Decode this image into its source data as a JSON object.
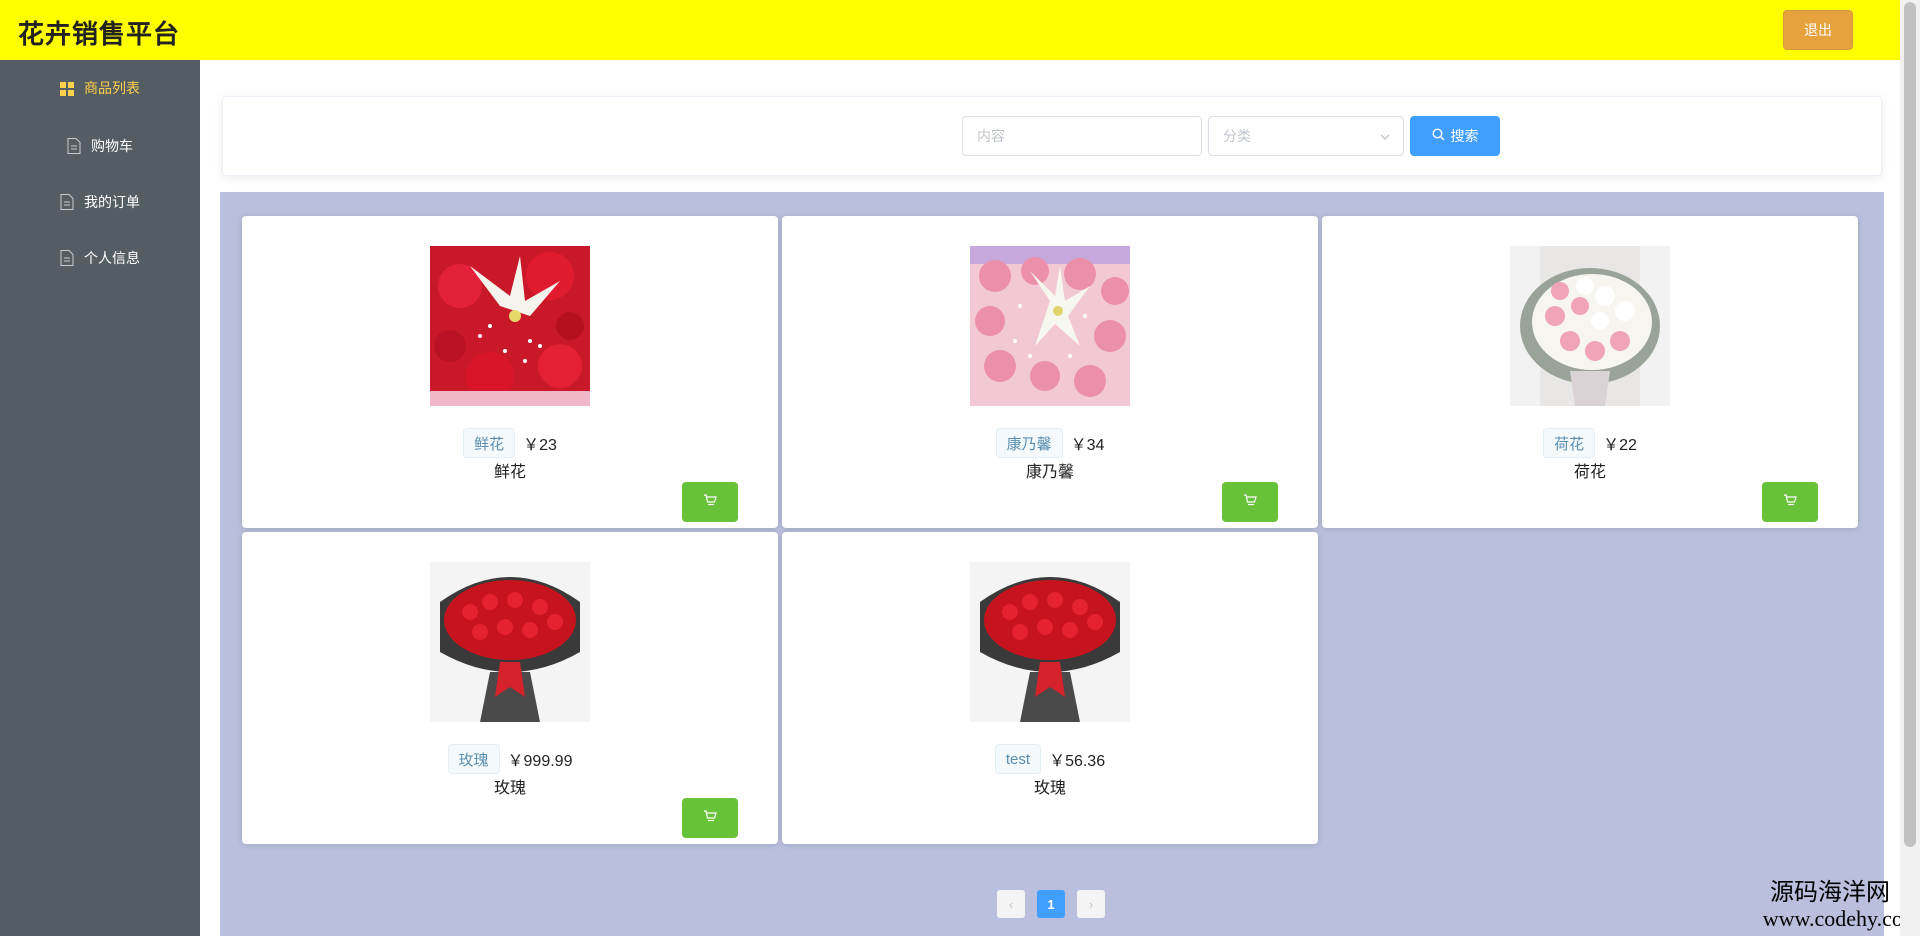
{
  "header": {
    "title": "花卉销售平台",
    "logout_label": "退出"
  },
  "sidebar": {
    "items": [
      {
        "label": "商品列表",
        "icon": "grid-icon",
        "active": true
      },
      {
        "label": "购物车",
        "icon": "document-icon",
        "active": false
      },
      {
        "label": "我的订单",
        "icon": "document-icon",
        "active": false
      },
      {
        "label": "个人信息",
        "icon": "document-icon",
        "active": false
      }
    ]
  },
  "search": {
    "keyword_placeholder": "内容",
    "category_placeholder": "分类",
    "button_label": "搜索"
  },
  "goods": [
    {
      "tag": "鲜花",
      "price": "￥23",
      "name": "鲜花",
      "image": "red-roses-lilies-bouquet"
    },
    {
      "tag": "康乃馨",
      "price": "￥34",
      "name": "康乃馨",
      "image": "pink-carnations-bouquet"
    },
    {
      "tag": "荷花",
      "price": "￥22",
      "name": "荷花",
      "image": "pink-white-roses-bouquet"
    },
    {
      "tag": "玫瑰",
      "price": "￥999.99",
      "name": "玫瑰",
      "image": "red-roses-bouquet"
    },
    {
      "tag": "test",
      "price": "￥56.36",
      "name": "玫瑰",
      "image": "red-roses-bouquet"
    }
  ],
  "pagination": {
    "current_page": "1",
    "prev_label": "‹",
    "next_label": "›"
  },
  "watermark": {
    "line1": "源码海洋网",
    "line2": "www.codehy.com"
  },
  "colors": {
    "header_bg": "#ffff00",
    "sidebar_bg": "#545c64",
    "active_menu": "#ffd04b",
    "primary": "#409eff",
    "success": "#67c23a",
    "warning": "#e6a23c",
    "panel_bg": "#b9bfdc"
  }
}
